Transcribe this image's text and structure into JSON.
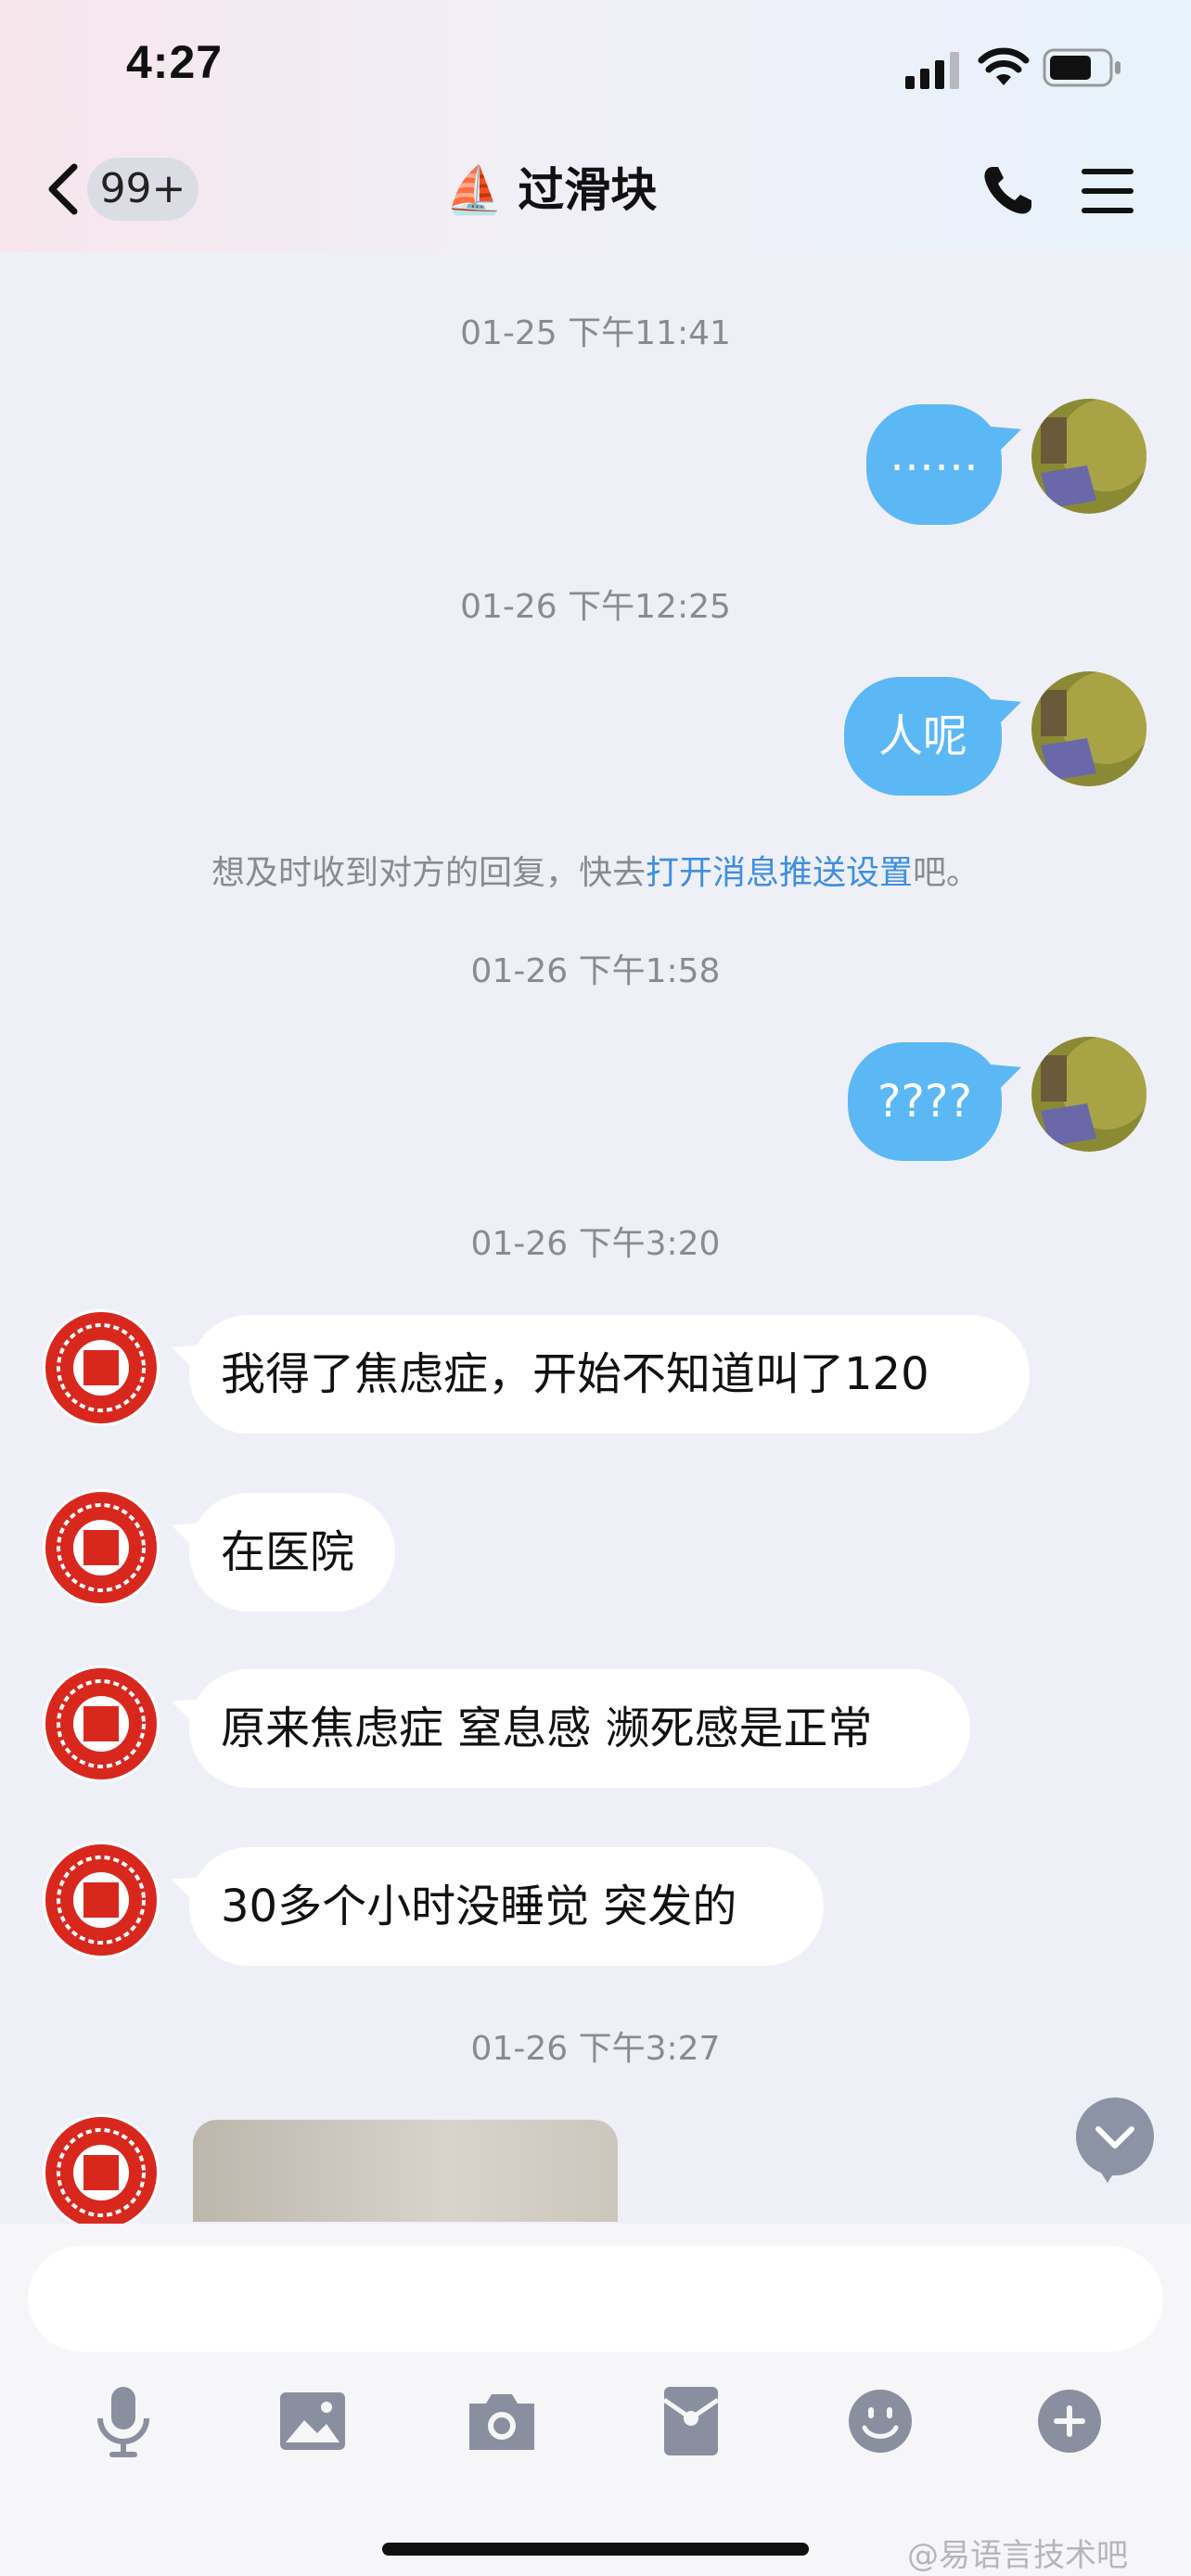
{
  "status_bar": {
    "time": "4:27"
  },
  "nav": {
    "back_count": "99+",
    "title": "过滑块",
    "title_emoji": "⛵"
  },
  "messages": {
    "ts1": "01-25 下午11:41",
    "m1": "……",
    "ts2": "01-26 下午12:25",
    "m2": "人呢",
    "notice_prefix": "想及时收到对方的回复，快去",
    "notice_link": "打开消息推送设置",
    "notice_suffix": "吧。",
    "ts3": "01-26 下午1:58",
    "m3": "????",
    "ts4": "01-26 下午3:20",
    "m4": "我得了焦虑症，开始不知道叫了120",
    "m5": "在医院",
    "m6": "原来焦虑症 窒息感 濒死感是正常",
    "m7": "30多个小时没睡觉 突发的",
    "ts5": "01-26 下午3:27"
  },
  "input": {
    "placeholder": ""
  },
  "watermark": "@易语言技术吧",
  "colors": {
    "outgoing_bubble": "#5cb8f4",
    "incoming_bubble": "#ffffff",
    "link": "#3d8fe0",
    "background": "#efeff7"
  }
}
